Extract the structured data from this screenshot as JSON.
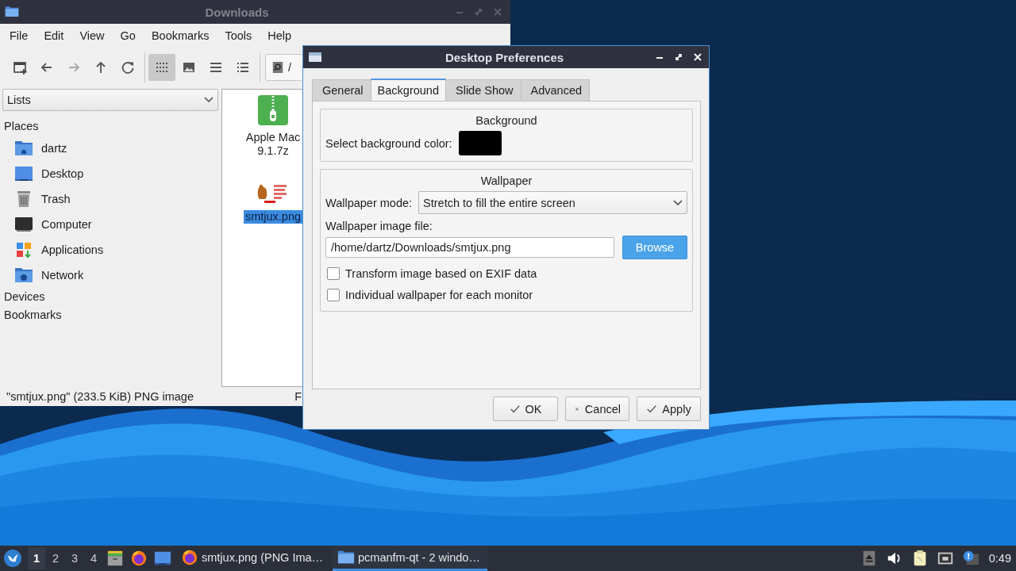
{
  "file_manager": {
    "title": "Downloads",
    "menu": [
      "File",
      "Edit",
      "View",
      "Go",
      "Bookmarks",
      "Tools",
      "Help"
    ],
    "nav_buttons": [
      {
        "kind": "new-tab",
        "disabled": false
      },
      {
        "kind": "back",
        "disabled": false
      },
      {
        "kind": "forward",
        "disabled": true
      },
      {
        "kind": "up",
        "disabled": false
      },
      {
        "kind": "reload",
        "disabled": false
      }
    ],
    "view_modes": [
      {
        "kind": "icons",
        "selected": true
      },
      {
        "kind": "thumbnails",
        "selected": false
      },
      {
        "kind": "compact",
        "selected": false
      },
      {
        "kind": "details",
        "selected": false
      }
    ],
    "location": "/",
    "side_pane": {
      "mode": "Lists",
      "sections": [
        {
          "label": "Places",
          "children": [
            {
              "label": "dartz",
              "kind": "home"
            },
            {
              "label": "Desktop",
              "kind": "desktop"
            },
            {
              "label": "Trash",
              "kind": "trash"
            },
            {
              "label": "Computer",
              "kind": "computer"
            },
            {
              "label": "Applications",
              "kind": "applications"
            },
            {
              "label": "Network",
              "kind": "network"
            }
          ]
        },
        {
          "label": "Devices"
        },
        {
          "label": "Bookmarks"
        }
      ]
    },
    "files": [
      {
        "name_lines": [
          "Apple Mac",
          "9.1.7z"
        ],
        "kind": "archive",
        "selected": false
      },
      {
        "name_lines": [
          "smtjux.png"
        ],
        "kind": "picture",
        "selected": true
      }
    ],
    "status_bar": {
      "text": "\"smtjux.png\" (233.5 KiB) PNG image",
      "right": "F"
    }
  },
  "dialog": {
    "title": "Desktop Preferences",
    "tabs": [
      {
        "label": "General",
        "selected": false
      },
      {
        "label": "Background",
        "selected": true
      },
      {
        "label": "Slide Show",
        "selected": false
      },
      {
        "label": "Advanced",
        "selected": false
      }
    ],
    "background_group": {
      "title": "Background",
      "color_label": "Select background color:",
      "color": "#000000"
    },
    "wallpaper_group": {
      "title": "Wallpaper",
      "mode_label": "Wallpaper mode:",
      "mode": "Stretch to fill the entire screen",
      "file_label": "Wallpaper image file:",
      "file": "/home/dartz/Downloads/smtjux.png",
      "browse": "Browse",
      "options": [
        {
          "label": "Transform image based on EXIF data",
          "checked": false
        },
        {
          "label": "Individual wallpaper for each monitor",
          "checked": false
        }
      ]
    },
    "buttons": [
      {
        "label": "OK",
        "kind": "ok"
      },
      {
        "label": "Cancel",
        "kind": "cancel"
      },
      {
        "label": "Apply",
        "kind": "apply"
      }
    ]
  },
  "taskbar": {
    "desktops": [
      {
        "label": "1",
        "selected": true
      },
      {
        "label": "2",
        "selected": false
      },
      {
        "label": "3",
        "selected": false
      },
      {
        "label": "4",
        "selected": false
      }
    ],
    "launchers": [
      {
        "kind": "file-cabinet"
      },
      {
        "kind": "browser"
      },
      {
        "kind": "desktop"
      }
    ],
    "tasks": [
      {
        "label": "smtjux.png (PNG Ima…",
        "kind": "browser",
        "selected": false
      },
      {
        "label": "pcmanfm-qt - 2 windo…",
        "kind": "folder",
        "selected": true
      }
    ],
    "tray": [
      {
        "kind": "eject"
      },
      {
        "kind": "volume"
      },
      {
        "kind": "clipboard"
      },
      {
        "kind": "network"
      },
      {
        "kind": "notification"
      }
    ],
    "clock": "0:49"
  }
}
